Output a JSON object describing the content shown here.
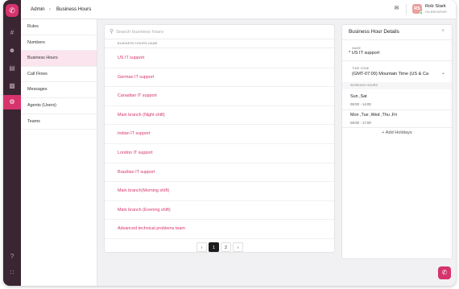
{
  "header": {
    "section": "Admin",
    "page": "Business Hours",
    "separator": "›"
  },
  "user": {
    "name": "Rob Stark",
    "status": "ON BROWSER",
    "initials": "RS"
  },
  "icons": {
    "app_logo": "phone-icon",
    "rail": [
      "hash-icon",
      "users-icon",
      "inbox-icon",
      "chart-icon",
      "gear-icon"
    ],
    "rail_bottom": [
      "help-icon",
      "grid-icon"
    ],
    "bell": "bell-icon",
    "search": "search-icon",
    "call_fab": "phone-icon"
  },
  "subnav": {
    "items": [
      {
        "label": "Rules"
      },
      {
        "label": "Numbers"
      },
      {
        "label": "Business Hours"
      },
      {
        "label": "Call Flows"
      },
      {
        "label": "Messages"
      },
      {
        "label": "Agents (Users)"
      },
      {
        "label": "Teams"
      }
    ]
  },
  "list": {
    "search_placeholder": "Search business hours",
    "column_header": "BUSINESS HOURS NAME",
    "rows": [
      "US IT support",
      "German IT support",
      "Canadian IT support",
      "Main branch (Night shift)",
      "Indian IT support",
      "London IT support",
      "Brazilian IT support",
      "Main branch(Morning shift)",
      "Main branch (Evening shift)",
      "Advanced technical problems team"
    ],
    "pagination": {
      "prev": "‹",
      "pages": [
        "1",
        "2"
      ],
      "next": "›",
      "current": "1"
    }
  },
  "details": {
    "title": "Business Hour Details",
    "close": "×",
    "name_label": "NAME",
    "name_value": "* US IT support",
    "timezone_label": "TIME ZONE",
    "timezone_value": "(GMT-07:00) Mountain Time (US & Ca",
    "working_hours_label": "WORKING HOURS",
    "schedules": [
      {
        "days": "Sun ,Sat",
        "hours": "08:00 - 14:00"
      },
      {
        "days": "Mon ,Tue ,Wed ,Thu ,Fri",
        "hours": "08:00 - 17:00"
      }
    ],
    "add_holidays": "+ Add Holidays"
  },
  "colors": {
    "accent": "#d6336c",
    "rail": "#3a2532",
    "active_nav": "#fbe4ee"
  }
}
